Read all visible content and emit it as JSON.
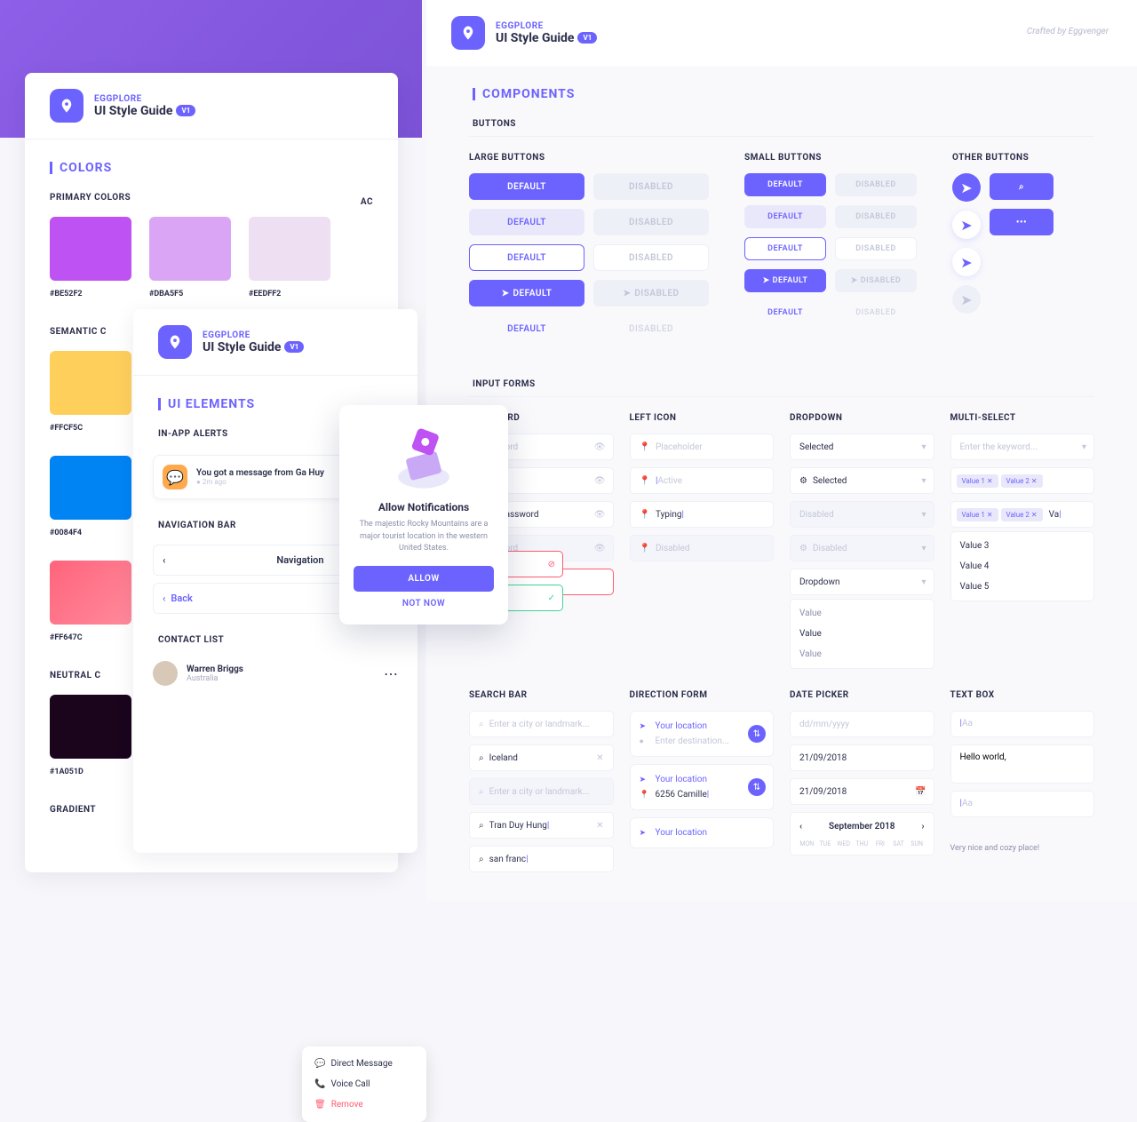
{
  "brand": {
    "small": "EGGPLORE",
    "title": "UI Style Guide",
    "ver": "V1"
  },
  "crafted": "Crafted by Eggvenger",
  "sections": {
    "colors": "COLORS",
    "components": "COMPONENTS",
    "uiel": "UI ELEMENTS"
  },
  "colors": {
    "primary_h": "PRIMARY COLORS",
    "ac_h": "AC",
    "primary": [
      {
        "hex": "#BE52F2",
        "c": "#BE52F2"
      },
      {
        "hex": "#DBA5F5",
        "c": "#DBA5F5"
      },
      {
        "hex": "#EEDFF2",
        "c": "#EEDFF2"
      }
    ],
    "semantic_h": "SEMANTIC C",
    "semantic": [
      {
        "hex": "#FFCF5C",
        "c": "#FFCF5C"
      },
      {
        "hex": "#0084F4",
        "c": "#0084F4"
      },
      {
        "hex": "#FF647C",
        "c": "#FF647C"
      }
    ],
    "neutral_h": "NEUTRAL C",
    "neutral": [
      {
        "hex": "#1A051D",
        "c": "#1A051D"
      }
    ],
    "gradient_h": "GRADIENT"
  },
  "uiel": {
    "alerts_h": "IN-APP ALERTS",
    "alert": {
      "text": "You got a message from Ga Huy",
      "sub": "● 2m ago"
    },
    "nav_h": "NAVIGATION BAR",
    "nav1": "Navigation",
    "nav2": "Back",
    "chev_l": "‹",
    "contact_h": "CONTACT LIST",
    "contact": {
      "name": "Warren Briggs",
      "sub": "Australia"
    },
    "menu": {
      "dm": "Direct Message",
      "vc": "Voice Call",
      "rm": "Remove"
    }
  },
  "comp": {
    "buttons_h": "BUTTONS",
    "lb_h": "LARGE BUTTONS",
    "sb_h": "SMALL BUTTONS",
    "ob_h": "OTHER BUTTONS",
    "default": "DEFAULT",
    "disabled": "DISABLED",
    "with_icon": "DEFAULT",
    "dots": "•••",
    "inputs_h": "INPUT FORMS",
    "pw_h": "PASSWORD",
    "li_h": "LEFT ICON",
    "dd_h": "DROPDOWN",
    "ms_h": "MULTI-SELECT",
    "pw_ph": "Password",
    "pw_masked": "•••••",
    "pw_shown": "thisispassword",
    "li_ph": "Placeholder",
    "li_active": "Active",
    "li_typing": "Typing",
    "li_dis": "Disabled",
    "dd_sel": "Selected",
    "dd_dis": "Disabled",
    "dd_open": "Dropdown",
    "dd_val": "Value",
    "ms_ph": "Enter the keyword...",
    "ms_v1": "Value 1",
    "ms_v2": "Value 2",
    "ms_typing": "Va",
    "ms_list": [
      "Value 3",
      "Value 4",
      "Value 5"
    ],
    "sb_head": "SEARCH BAR",
    "df_head": "DIRECTION FORM",
    "dp_head": "DATE PICKER",
    "tb_head": "TEXT BOX",
    "sb_ph": "Enter a city or landmark...",
    "sb_iceland": "Iceland",
    "sb_tdh": "Tran Duy Hung",
    "sb_sf": "san franc",
    "df_loc": "Your location",
    "df_dest": "Enter destination...",
    "df_addr": "6256 Camille",
    "dp_ph": "dd/mm/yyyy",
    "dp_date": "21/09/2018",
    "dp_month": "September 2018",
    "days": [
      "MON",
      "TUE",
      "WED",
      "THU",
      "FRI",
      "SAT",
      "SUN"
    ],
    "tb_ph": "Aa",
    "tb_val": "Hello world,",
    "tb_foot": "Very nice and cozy place!"
  },
  "modal": {
    "title": "Allow Notifications",
    "body": "The majestic Rocky Mountains are a major tourist location in the western United States.",
    "allow": "ALLOW",
    "notnow": "NOT NOW"
  }
}
